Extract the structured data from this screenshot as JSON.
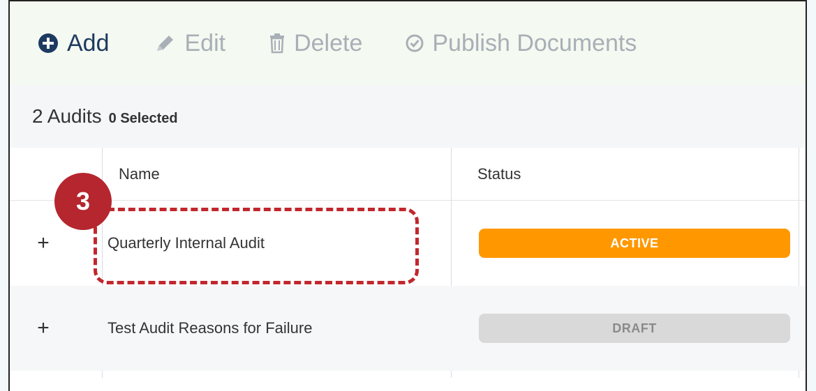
{
  "toolbar": {
    "add_label": "Add",
    "edit_label": "Edit",
    "delete_label": "Delete",
    "publish_label": "Publish Documents"
  },
  "summary": {
    "count_text": "2 Audits",
    "selected_text": "0 Selected"
  },
  "table": {
    "columns": [
      "Name",
      "Status"
    ],
    "rows": [
      {
        "expander": "+",
        "name": "Quarterly Internal Audit",
        "status": "ACTIVE"
      },
      {
        "expander": "+",
        "name": "Test Audit Reasons for Failure",
        "status": "DRAFT"
      }
    ]
  },
  "annotation": {
    "step_number": "3"
  },
  "colors": {
    "active": "#ff9800",
    "draft": "#d9d9d9",
    "callout": "#c1272d",
    "primary": "#1e3a60"
  }
}
